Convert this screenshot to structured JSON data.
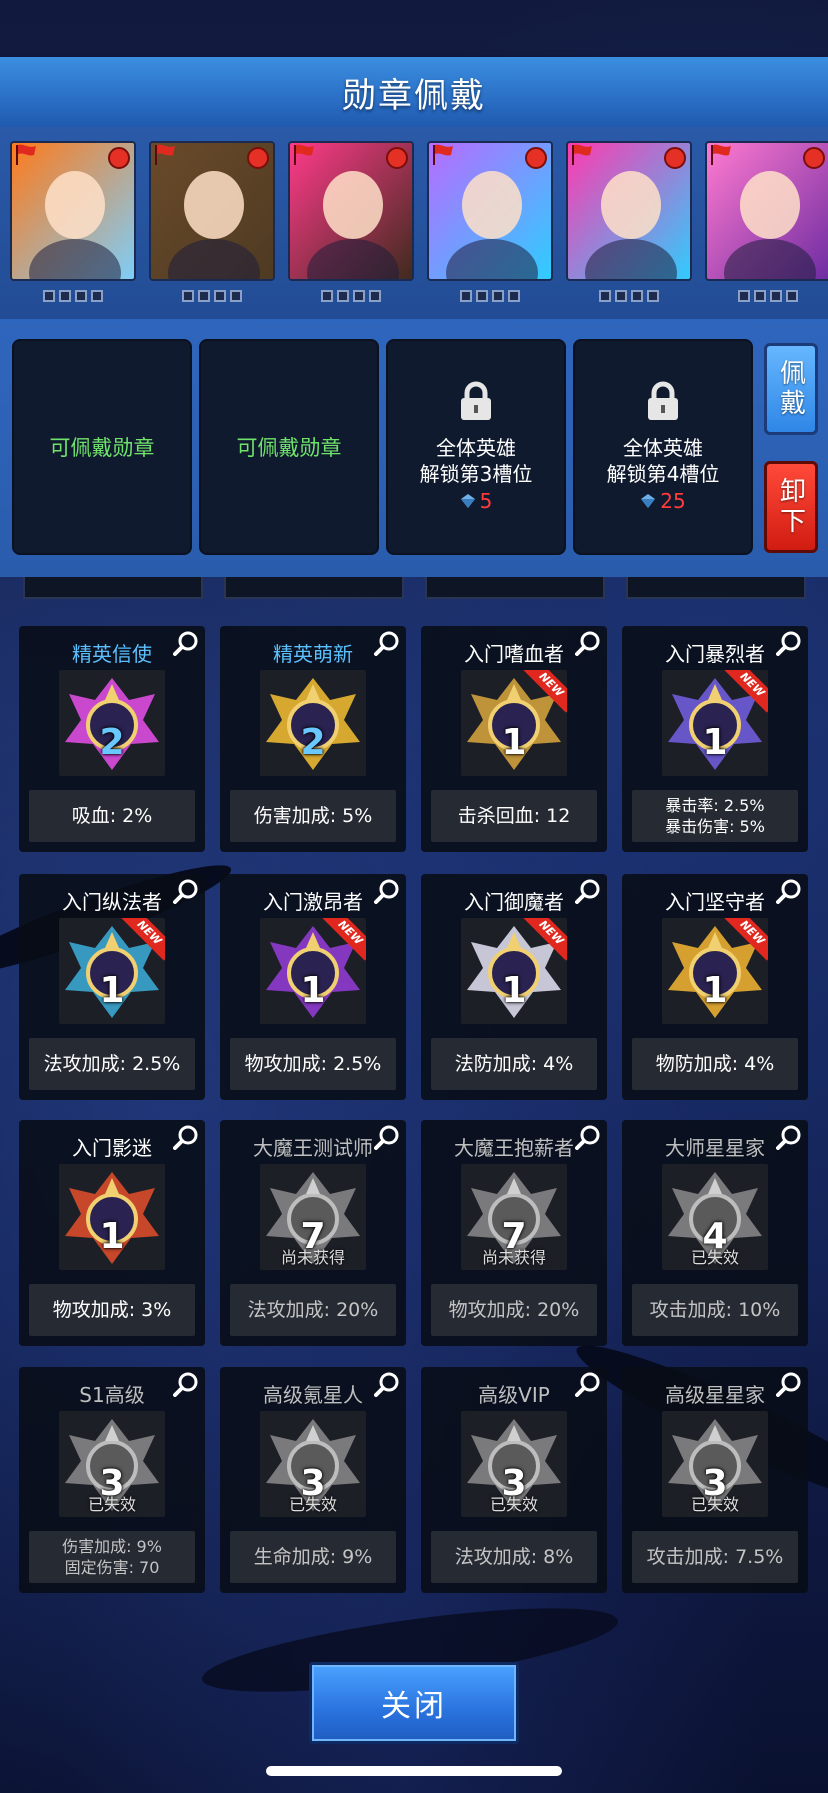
{
  "header": {
    "title": "勋章佩戴"
  },
  "heroes": [
    {
      "name": "hero-1",
      "colors": [
        "#ff7a1a",
        "#7ad0ff"
      ]
    },
    {
      "name": "hero-2",
      "colors": [
        "#6a4a2a",
        "#4d3a22"
      ]
    },
    {
      "name": "hero-3",
      "colors": [
        "#ff3a8a",
        "#3a2a1a"
      ]
    },
    {
      "name": "hero-4",
      "colors": [
        "#b86bff",
        "#2ad0ff"
      ]
    },
    {
      "name": "hero-5",
      "colors": [
        "#ff3ab0",
        "#2ad0ff"
      ]
    },
    {
      "name": "hero-6",
      "colors": [
        "#ff7ad0",
        "#6a2aa0"
      ]
    }
  ],
  "slots": [
    {
      "type": "available",
      "label": "可佩戴勋章"
    },
    {
      "type": "available",
      "label": "可佩戴勋章"
    },
    {
      "type": "locked",
      "line1": "全体英雄",
      "line2": "解锁第3槽位",
      "cost": "5"
    },
    {
      "type": "locked",
      "line1": "全体英雄",
      "line2": "解锁第4槽位",
      "cost": "25"
    }
  ],
  "side_buttons": {
    "wear": "佩戴",
    "remove": "卸下"
  },
  "badges": [
    {
      "name": "精英信使",
      "name_color": "blue",
      "level": "2",
      "level_color": "blue",
      "tint": "#d44bd6",
      "new": false,
      "status": "",
      "stat": [
        "吸血: 2%"
      ],
      "locked": false
    },
    {
      "name": "精英萌新",
      "name_color": "blue",
      "level": "2",
      "level_color": "blue",
      "tint": "#e0b030",
      "new": false,
      "status": "",
      "stat": [
        "伤害加成: 5%"
      ],
      "locked": false
    },
    {
      "name": "入门嗜血者",
      "name_color": "white",
      "level": "1",
      "level_color": "white",
      "tint": "#c89a3a",
      "new": true,
      "status": "",
      "stat": [
        "击杀回血: 12"
      ],
      "locked": false
    },
    {
      "name": "入门暴烈者",
      "name_color": "white",
      "level": "1",
      "level_color": "white",
      "tint": "#6a5ad0",
      "new": true,
      "status": "",
      "stat": [
        "暴击率: 2.5%",
        "暴击伤害: 5%"
      ],
      "locked": false
    },
    {
      "name": "入门纵法者",
      "name_color": "white",
      "level": "1",
      "level_color": "white",
      "tint": "#3aa0c8",
      "new": true,
      "status": "",
      "stat": [
        "法攻加成: 2.5%"
      ],
      "locked": false
    },
    {
      "name": "入门激昂者",
      "name_color": "white",
      "level": "1",
      "level_color": "white",
      "tint": "#8a3ac8",
      "new": true,
      "status": "",
      "stat": [
        "物攻加成: 2.5%"
      ],
      "locked": false
    },
    {
      "name": "入门御魔者",
      "name_color": "white",
      "level": "1",
      "level_color": "white",
      "tint": "#d0d0e0",
      "new": true,
      "status": "",
      "stat": [
        "法防加成: 4%"
      ],
      "locked": false
    },
    {
      "name": "入门坚守者",
      "name_color": "white",
      "level": "1",
      "level_color": "white",
      "tint": "#e0a830",
      "new": true,
      "status": "",
      "stat": [
        "物防加成: 4%"
      ],
      "locked": false
    },
    {
      "name": "入门影迷",
      "name_color": "white",
      "level": "1",
      "level_color": "white",
      "tint": "#d04a2a",
      "new": false,
      "status": "",
      "stat": [
        "物攻加成: 3%"
      ],
      "locked": false
    },
    {
      "name": "大魔王测试师",
      "name_color": "grey",
      "level": "7",
      "level_color": "white",
      "tint": "#9a9a9a",
      "new": false,
      "status": "尚未获得",
      "stat": [
        "法攻加成: 20%"
      ],
      "locked": true
    },
    {
      "name": "大魔王抱薪者",
      "name_color": "grey",
      "level": "7",
      "level_color": "white",
      "tint": "#9a9a9a",
      "new": false,
      "status": "尚未获得",
      "stat": [
        "物攻加成: 20%"
      ],
      "locked": true
    },
    {
      "name": "大师星星家",
      "name_color": "grey",
      "level": "4",
      "level_color": "white",
      "tint": "#9a9a9a",
      "new": false,
      "status": "已失效",
      "stat": [
        "攻击加成: 10%"
      ],
      "locked": true
    },
    {
      "name": "S1高级",
      "name_color": "grey",
      "level": "3",
      "level_color": "white",
      "tint": "#9a9a9a",
      "new": false,
      "status": "已失效",
      "stat": [
        "伤害加成: 9%",
        "固定伤害: 70"
      ],
      "locked": true
    },
    {
      "name": "高级氪星人",
      "name_color": "grey",
      "level": "3",
      "level_color": "white",
      "tint": "#9a9a9a",
      "new": false,
      "status": "已失效",
      "stat": [
        "生命加成: 9%"
      ],
      "locked": true
    },
    {
      "name": "高级VIP",
      "name_color": "grey",
      "level": "3",
      "level_color": "white",
      "tint": "#9a9a9a",
      "new": false,
      "status": "已失效",
      "stat": [
        "法攻加成: 8%"
      ],
      "locked": true
    },
    {
      "name": "高级星星家",
      "name_color": "grey",
      "level": "3",
      "level_color": "white",
      "tint": "#9a9a9a",
      "new": false,
      "status": "已失效",
      "stat": [
        "攻击加成: 7.5%"
      ],
      "locked": true
    }
  ],
  "new_label": "NEW",
  "close_button": "关闭"
}
